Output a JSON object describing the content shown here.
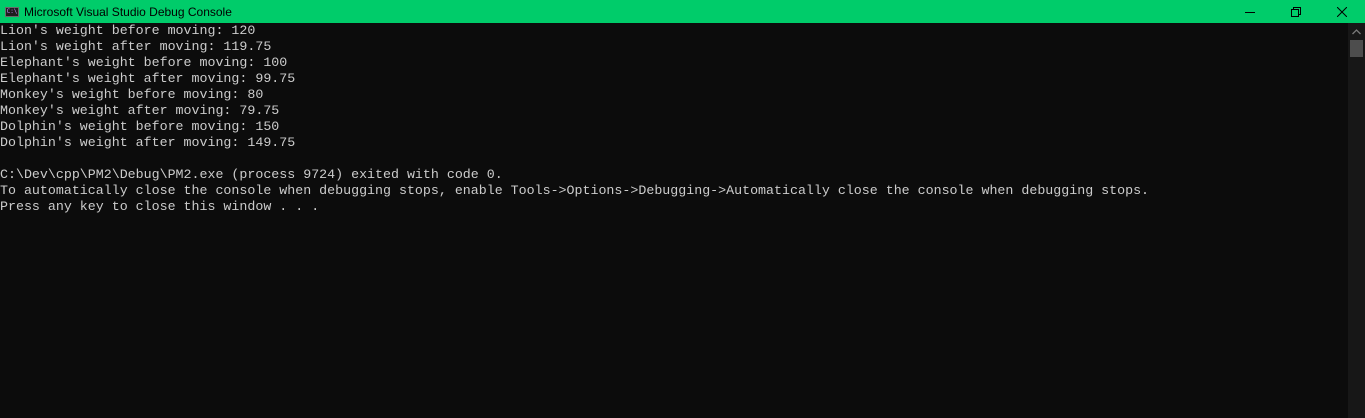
{
  "window": {
    "title": "Microsoft Visual Studio Debug Console",
    "icon_text": "C:\\",
    "controls": [
      "minimize-icon",
      "restore-icon",
      "close-icon"
    ],
    "titlebar_color": "#00cc6a"
  },
  "console": {
    "background": "#0c0c0c",
    "foreground": "#cccccc",
    "lines": [
      "Lion's weight before moving: 120",
      "Lion's weight after moving: 119.75",
      "Elephant's weight before moving: 100",
      "Elephant's weight after moving: 99.75",
      "Monkey's weight before moving: 80",
      "Monkey's weight after moving: 79.75",
      "Dolphin's weight before moving: 150",
      "Dolphin's weight after moving: 149.75",
      "",
      "C:\\Dev\\cpp\\PM2\\Debug\\PM2.exe (process 9724) exited with code 0.",
      "To automatically close the console when debugging stops, enable Tools->Options->Debugging->Automatically close the console when debugging stops.",
      "Press any key to close this window . . ."
    ]
  },
  "scrollbar": {
    "up_icon": "chevron-up-icon"
  }
}
